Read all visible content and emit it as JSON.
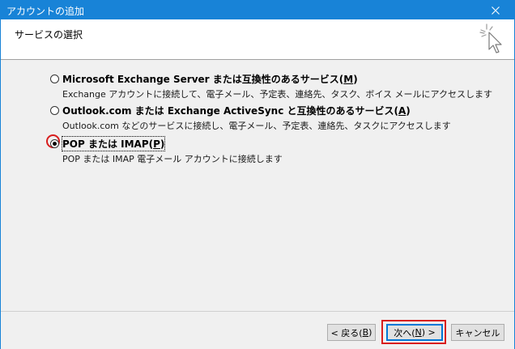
{
  "window": {
    "title": "アカウントの追加"
  },
  "header": {
    "heading": "サービスの選択"
  },
  "options": [
    {
      "label_prefix": "Microsoft Exchange Server または互換性のあるサービス(",
      "accel": "M",
      "label_suffix": ")",
      "description": "Exchange アカウントに接続して、電子メール、予定表、連絡先、タスク、ボイス メールにアクセスします",
      "checked": false
    },
    {
      "label_prefix": "Outlook.com または Exchange ActiveSync と互換性のあるサービス(",
      "accel": "A",
      "label_suffix": ")",
      "description": "Outlook.com などのサービスに接続し、電子メール、予定表、連絡先、タスクにアクセスします",
      "checked": false
    },
    {
      "label_prefix": "POP または IMAP(",
      "accel": "P",
      "label_suffix": ")",
      "description": "POP または IMAP 電子メール アカウントに接続します",
      "checked": true
    }
  ],
  "buttons": {
    "back_prefix": "< 戻る(",
    "back_accel": "B",
    "back_suffix": ")",
    "next_prefix": "次へ(",
    "next_accel": "N",
    "next_suffix": ") >",
    "cancel": "キャンセル"
  },
  "colors": {
    "titlebar": "#1883d7",
    "highlight": "#d81e1e",
    "default_button_border": "#0078d7"
  },
  "icons": {
    "close": "close-icon",
    "wizard": "wizard-cursor-icon"
  }
}
